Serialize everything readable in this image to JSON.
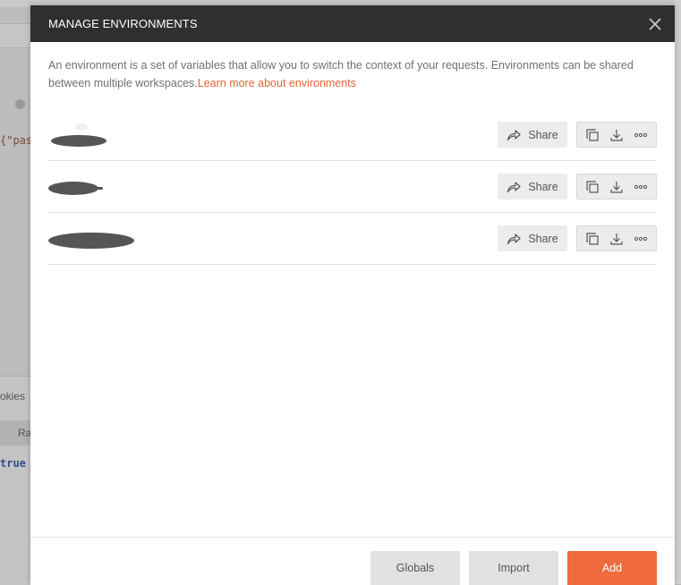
{
  "background": {
    "code_snippet": "{\"pas",
    "cookies_label": "okies",
    "tab_fragment": "Ra",
    "value_text": "true"
  },
  "modal": {
    "title": "MANAGE ENVIRONMENTS",
    "close_icon": "close-icon",
    "description": "An environment is a set of variables that allow you to switch the context of your requests. Environments can be shared between multiple workspaces.",
    "learn_more_link": "Learn more about environments",
    "share_label": "Share",
    "environments": [
      {
        "name": "",
        "redacted": true
      },
      {
        "name": "",
        "redacted": true
      },
      {
        "name": "",
        "redacted": true
      }
    ],
    "row_icons": [
      "share-arrow-icon",
      "duplicate-icon",
      "download-icon",
      "more-icon"
    ],
    "footer": {
      "globals_label": "Globals",
      "import_label": "Import",
      "add_label": "Add"
    },
    "colors": {
      "header_bg": "#2f2f2f",
      "accent": "#ef6a3e",
      "link": "#e4623a"
    }
  }
}
